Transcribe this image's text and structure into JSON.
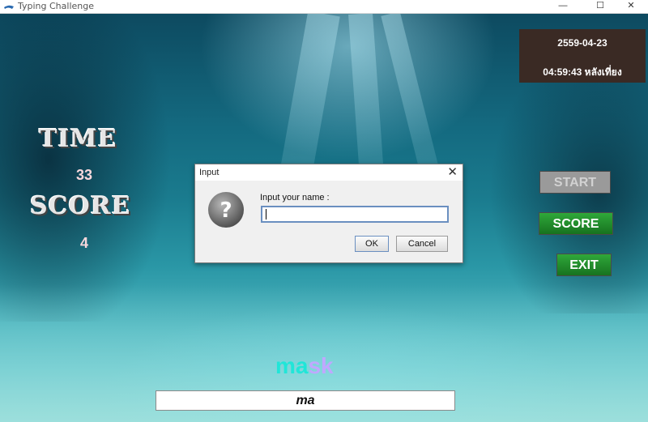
{
  "window": {
    "title": "Typing Challenge",
    "min_glyph": "—",
    "max_glyph": "☐",
    "close_glyph": "✕"
  },
  "clock": {
    "date": "2559-04-23",
    "time": "04:59:43 หลังเที่ยง"
  },
  "stats": {
    "time_label": "TIME",
    "time_value": "33",
    "score_label": "SCORE",
    "score_value": "4"
  },
  "buttons": {
    "start": "START",
    "score": "SCORE",
    "exit": "EXIT"
  },
  "word": {
    "typed": "ma",
    "remaining": "sk"
  },
  "typed_input": "ma",
  "dialog": {
    "title": "Input",
    "close_glyph": "✕",
    "icon_glyph": "?",
    "prompt": "Input your name :",
    "value": "",
    "ok": "OK",
    "cancel": "Cancel"
  },
  "colors": {
    "typed": "#20e6d8",
    "remaining": "#c0a8ff",
    "button_green": "#1f8a2a",
    "clock_bg": "#3a2a24"
  }
}
